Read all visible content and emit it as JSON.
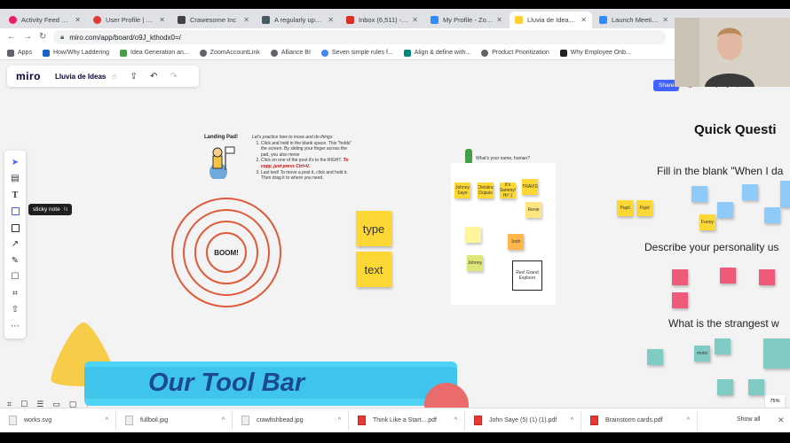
{
  "browser": {
    "tabs": [
      {
        "label": "Activity Feed desig",
        "color": "#e91e63"
      },
      {
        "label": "User Profile | Even",
        "color": "#e53935"
      },
      {
        "label": "Crawesome Inc",
        "color": "#424242"
      },
      {
        "label": "A regularly update",
        "color": "#455a64"
      },
      {
        "label": "Inbox (6,511) - ro",
        "color": "#d93025"
      },
      {
        "label": "My Profile - Zoom",
        "color": "#2d8cff"
      },
      {
        "label": "Lluvia de Ideas, On",
        "color": "#ffd02f",
        "active": true
      },
      {
        "label": "Launch Meeting - ",
        "color": "#2d8cff"
      }
    ],
    "url": "miro.com/app/board/o9J_kthodx0=/",
    "bookmarks": [
      {
        "label": "Apps",
        "color": "#5f6368"
      },
      {
        "label": "How/Why Laddering",
        "color": "#1565c0"
      },
      {
        "label": "Idea Generation an...",
        "color": "#43a047"
      },
      {
        "label": "ZoomAccountLink",
        "color": "#5f6368"
      },
      {
        "label": "Alliance BI",
        "color": "#5f6368"
      },
      {
        "label": "Seven simple rules f...",
        "color": "#4285f4"
      },
      {
        "label": "Align & define with...",
        "color": "#00897b"
      },
      {
        "label": "Product Prioritization",
        "color": "#5f6368"
      },
      {
        "label": "Why Employee Onb...",
        "color": "#222222"
      }
    ]
  },
  "miro": {
    "logo": "miro",
    "board_name": "Lluvia de Ideas",
    "share_label": "Share",
    "tooltip": {
      "label": "sticky note",
      "key": "N"
    },
    "zoom_level": "75%"
  },
  "board": {
    "landing_title": "Landing Pad!",
    "instructions": {
      "intro": "Let's practice how to move and do things",
      "steps": [
        "Click and hold in the blank space. This \"holds\" the screen. By sliding your finger across the pad, you also move",
        "Click on one of the post it's to the RIGHT.",
        "Last test! To move a post it, click and hold it. Then drag it to where you need."
      ],
      "highlight": "To copy, just press Ctrl+V."
    },
    "boom_label": "BOOM!",
    "big_stickies": [
      "type",
      "text"
    ],
    "name_question": "What's your name, human?",
    "name_stickies": [
      "Johnny Saye",
      "Christina Dupuis",
      "It's Sammy! Hi! :)",
      "TRAVIS",
      "Renie",
      "Josh",
      "Johnny",
      "Rex! Grand Explorer"
    ],
    "quick_title": "Quick Questi",
    "q1": "Fill in the blank \"When I da",
    "q2": "Describe your personality us",
    "q3": "What is the strangest w",
    "answer_labels": [
      "Pupil",
      "Pupil",
      "Funny",
      "moist"
    ]
  },
  "overlay": {
    "title": "Our Tool Bar"
  },
  "downloads": {
    "items": [
      {
        "name": "works.svg",
        "type": "svg"
      },
      {
        "name": "fullboil.jpg",
        "type": "jpg"
      },
      {
        "name": "crawfishbead.jpg",
        "type": "jpg"
      },
      {
        "name": "Think Like a Start....pdf",
        "type": "pdf"
      },
      {
        "name": "John Saye (5) (1) (1).pdf",
        "type": "pdf"
      },
      {
        "name": "Brainstorm cards.pdf",
        "type": "pdf"
      }
    ],
    "show_all": "Show all"
  }
}
